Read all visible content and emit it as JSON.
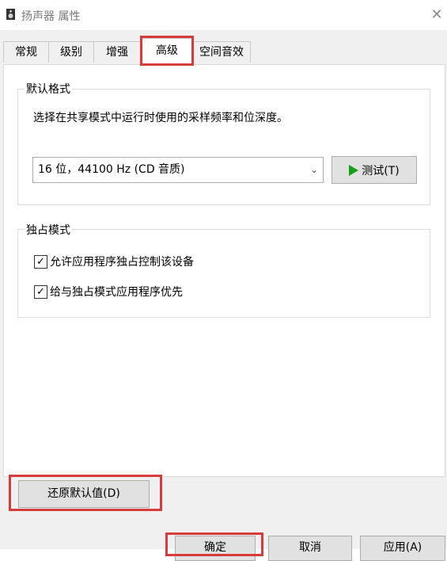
{
  "window": {
    "title": "扬声器 属性",
    "close_glyph": "✕"
  },
  "tabs": [
    {
      "label": "常规"
    },
    {
      "label": "级别"
    },
    {
      "label": "增强"
    },
    {
      "label": "高级",
      "active": true
    },
    {
      "label": "空间音效"
    }
  ],
  "default_format": {
    "legend": "默认格式",
    "description": "选择在共享模式中运行时使用的采样频率和位深度。",
    "selected_format": "16 位，44100 Hz (CD 音质)",
    "test_button": "测试(T)"
  },
  "exclusive_mode": {
    "legend": "独占模式",
    "options": [
      {
        "label": "允许应用程序独占控制该设备",
        "checked": true
      },
      {
        "label": "给与独占模式应用程序优先",
        "checked": true
      }
    ]
  },
  "restore_button": "还原默认值(D)",
  "footer": {
    "ok": "确定",
    "cancel": "取消",
    "apply": "应用(A)"
  },
  "colors": {
    "highlight_box": "#d83b3b",
    "play_icon": "#16a016"
  }
}
